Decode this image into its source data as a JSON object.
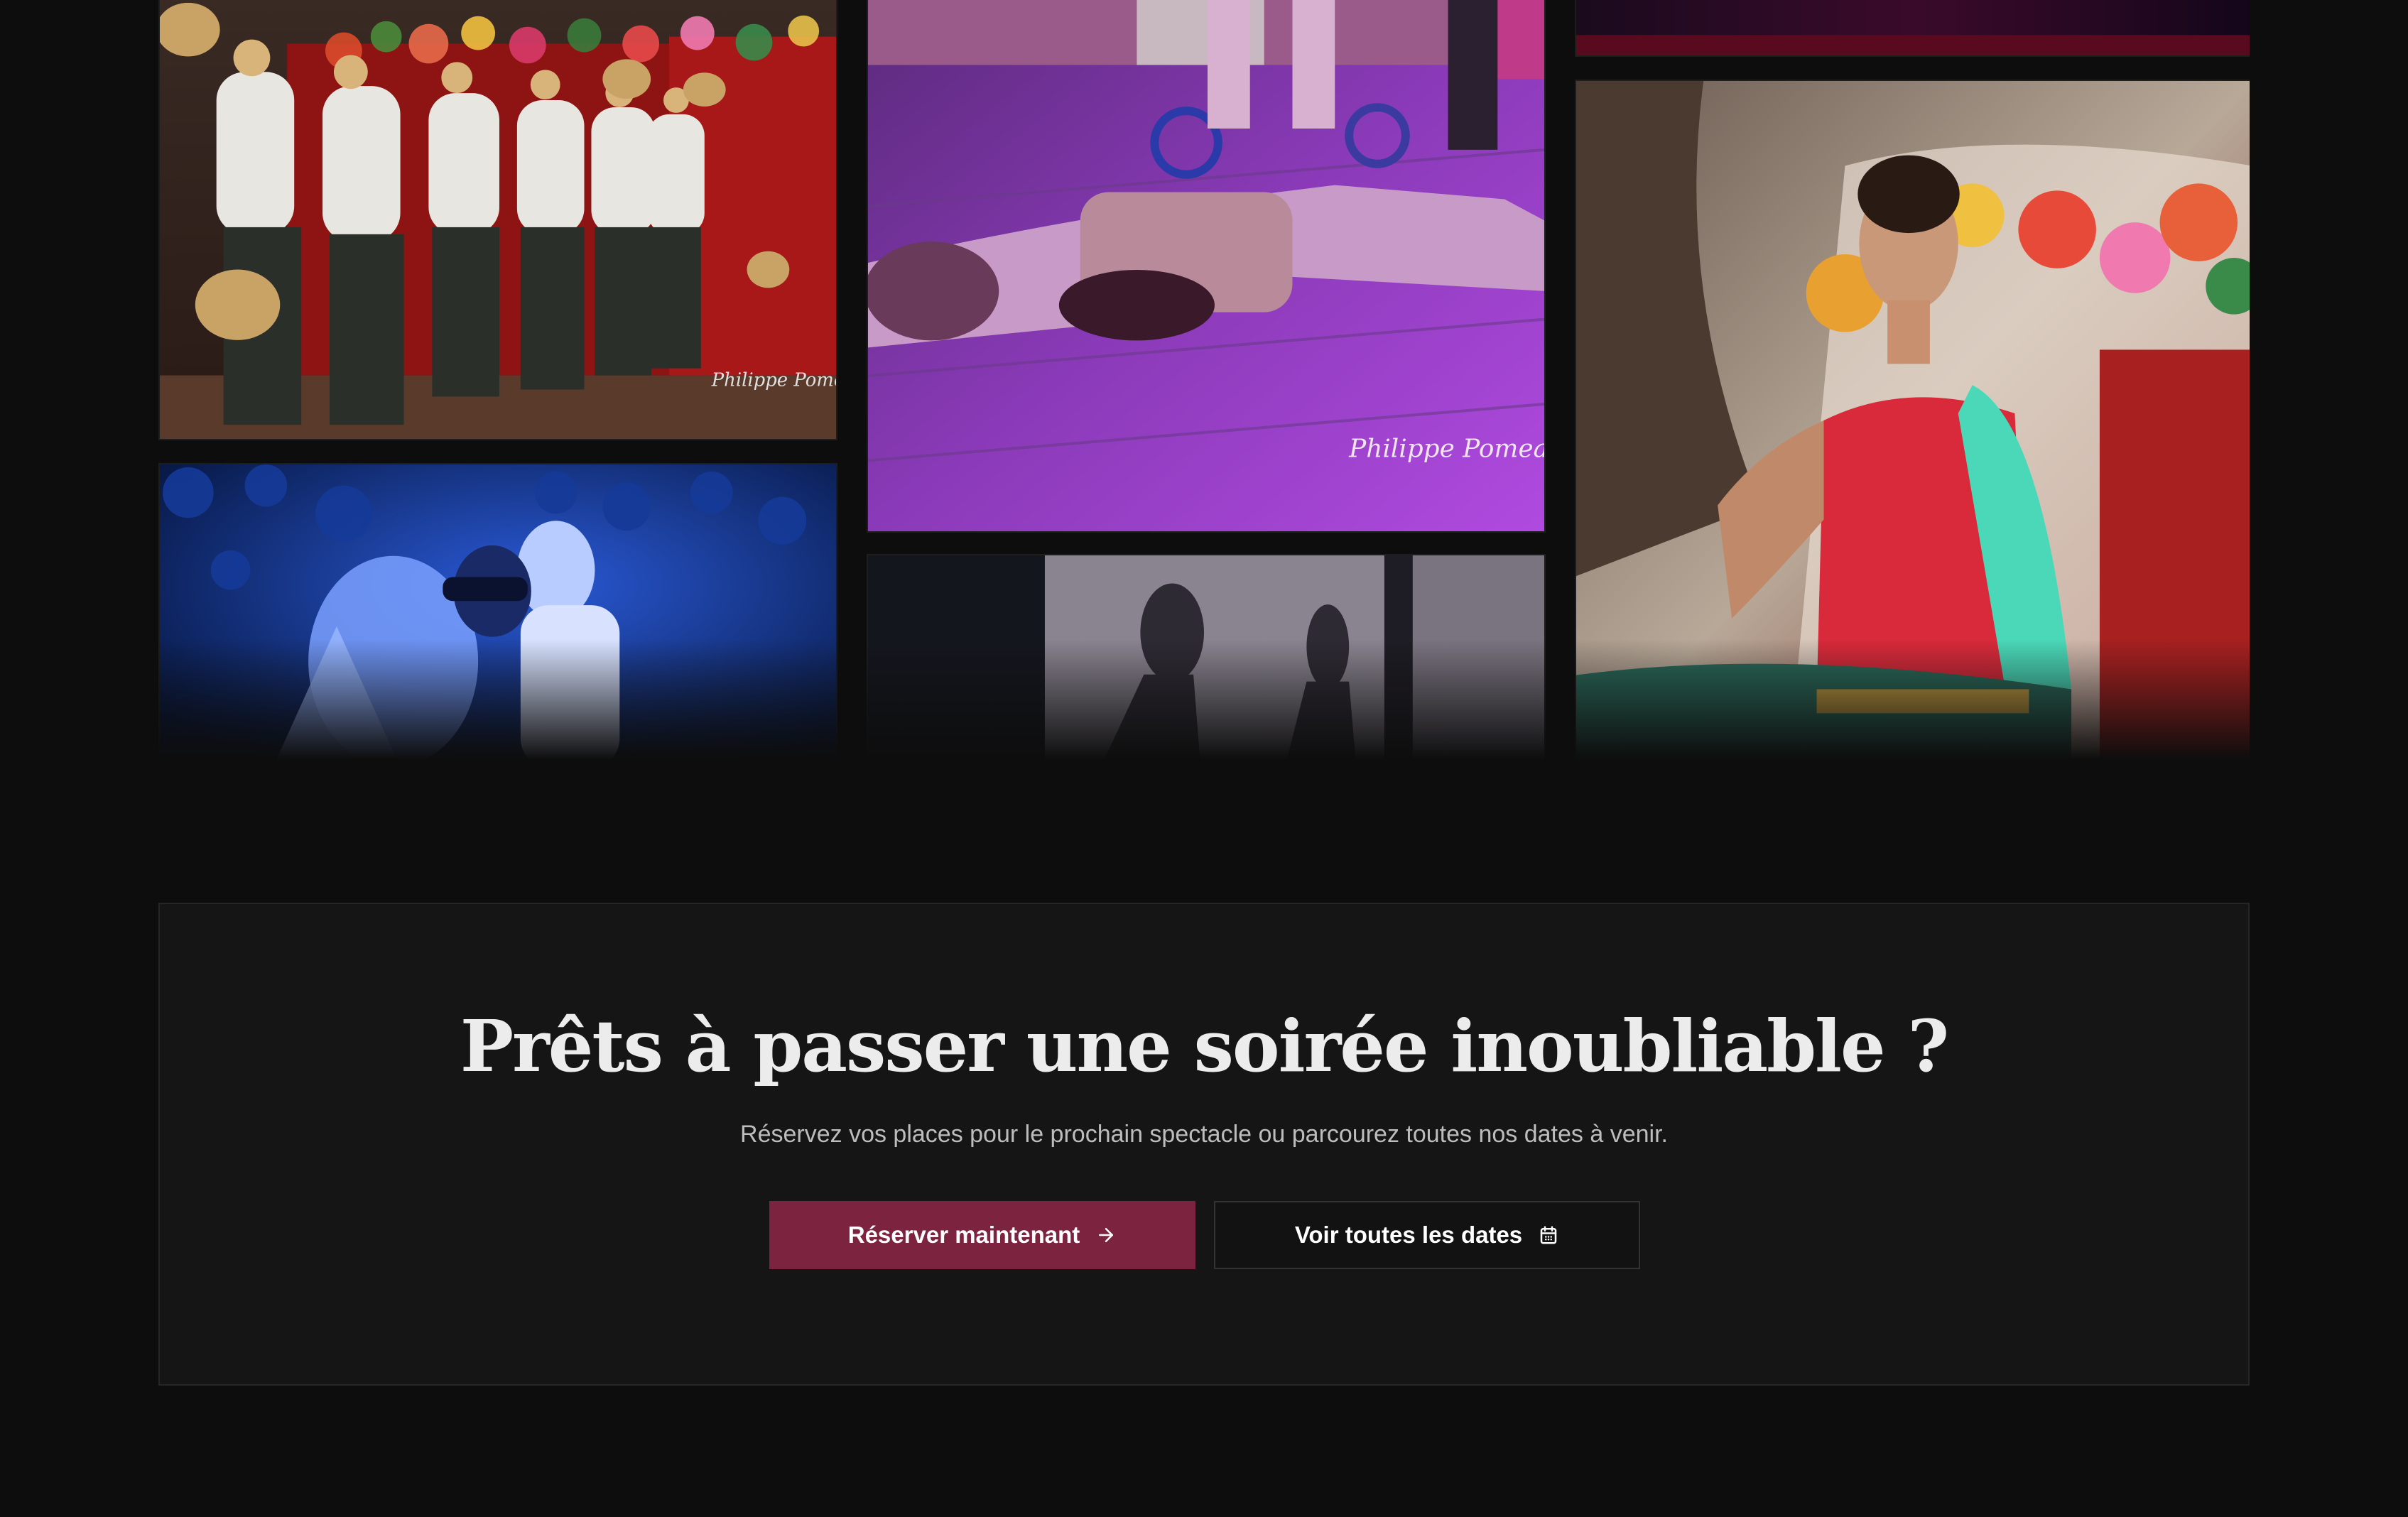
{
  "gallery": {
    "photos": [
      {
        "name": "photo-dancers-hats",
        "watermark": "Philippe Pomeaux"
      },
      {
        "name": "photo-floor-scene-purple",
        "watermark": "Philippe Pomeaux"
      },
      {
        "name": "photo-dark-top-right"
      },
      {
        "name": "photo-blue-masked-couple"
      },
      {
        "name": "photo-shadow-silhouettes"
      },
      {
        "name": "photo-indian-dancer"
      }
    ]
  },
  "cta": {
    "title": "Prêts à passer une soirée inoubliable ?",
    "subtitle": "Réservez vos places pour le prochain spectacle ou parcourez toutes nos dates à venir.",
    "primary_button": {
      "label": "Réserver maintenant",
      "icon": "arrow-right-icon"
    },
    "secondary_button": {
      "label": "Voir toutes les dates",
      "icon": "calendar-icon"
    }
  },
  "colors": {
    "background": "#0d0d0d",
    "panel": "#151515",
    "accent": "#7c2340",
    "text": "#ececec",
    "muted_text": "#bdbdbd"
  }
}
